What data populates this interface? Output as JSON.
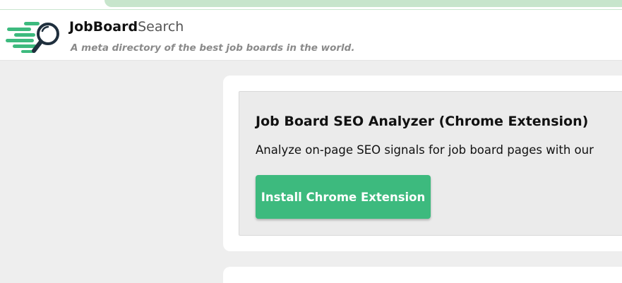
{
  "header": {
    "brand_bold": "JobBoard",
    "brand_light": "Search",
    "tagline": "A meta directory of the best job boards in the world.",
    "logo_icon": "magnifier-speed-lines-icon"
  },
  "card": {
    "title": "Job Board SEO Analyzer (Chrome Extension)",
    "description": "Analyze on-page SEO signals for job board pages with our",
    "button_label": "Install Chrome Extension"
  },
  "colors": {
    "accent": "#3dba7e",
    "logo_dark": "#1f2f3d",
    "background": "#eeeeee"
  }
}
